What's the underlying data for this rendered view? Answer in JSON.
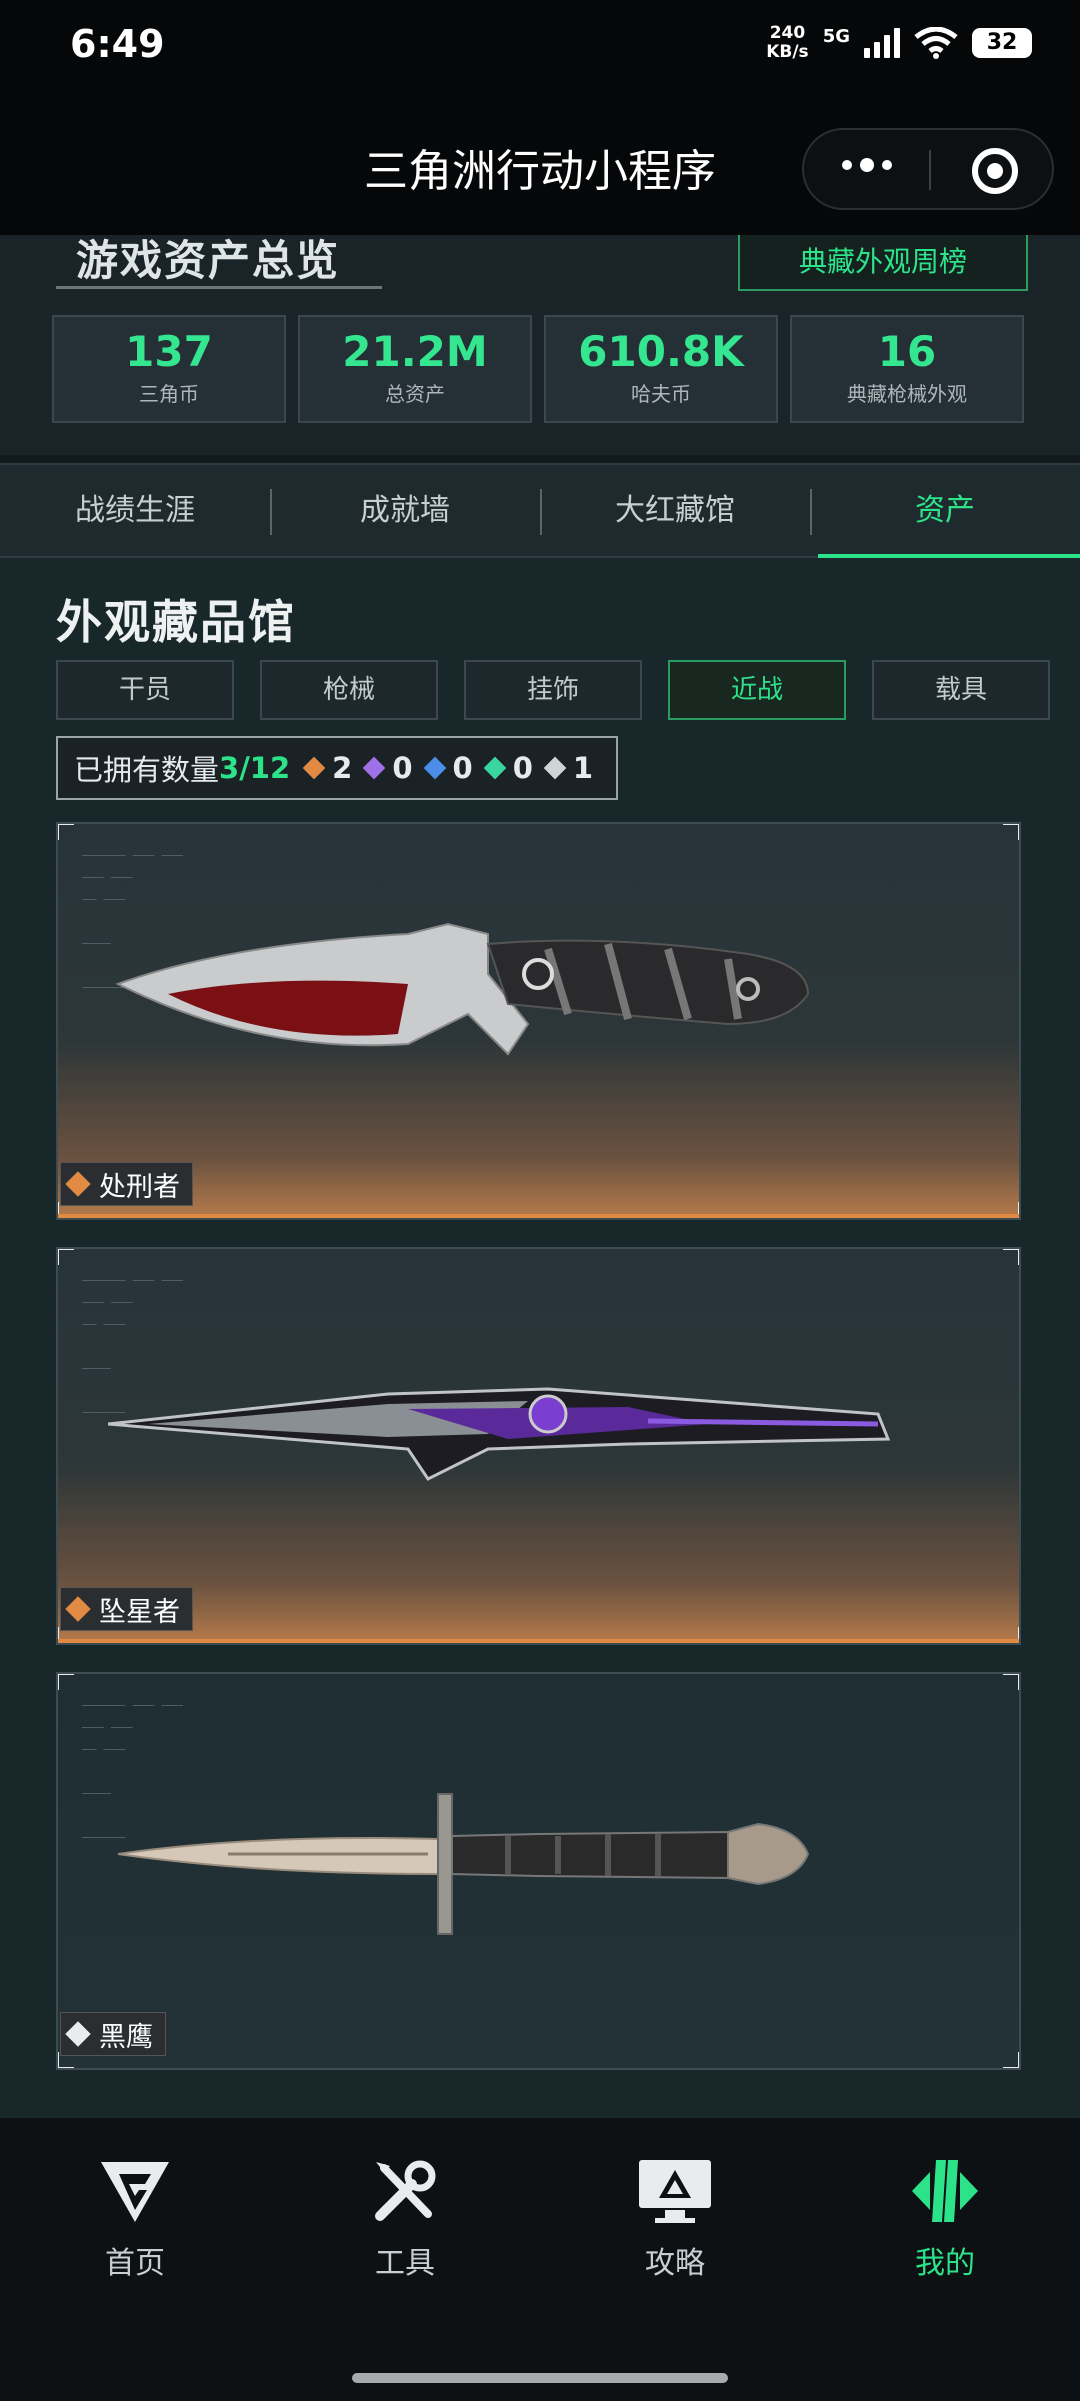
{
  "status_bar": {
    "time": "6:49",
    "net_speed_value": "240",
    "net_speed_unit": "KB/s",
    "net_type": "5G",
    "battery": "32"
  },
  "title_bar": {
    "title": "三角洲行动小程序"
  },
  "overview": {
    "title": "游戏资产总览",
    "weekly_button": "典藏外观周榜",
    "stats": [
      {
        "value": "137",
        "label": "三角币"
      },
      {
        "value": "21.2M",
        "label": "总资产"
      },
      {
        "value": "610.8K",
        "label": "哈夫币"
      },
      {
        "value": "16",
        "label": "典藏枪械外观"
      }
    ]
  },
  "tabs": [
    {
      "label": "战绩生涯"
    },
    {
      "label": "成就墙"
    },
    {
      "label": "大红藏馆"
    },
    {
      "label": "资产"
    }
  ],
  "gallery": {
    "title": "外观藏品馆",
    "filters": [
      {
        "label": "干员"
      },
      {
        "label": "枪械"
      },
      {
        "label": "挂饰"
      },
      {
        "label": "近战"
      },
      {
        "label": "载具"
      }
    ],
    "owned_label": "已拥有数量",
    "owned_count": "3/12",
    "rarity_counts": [
      {
        "value": "2",
        "color": "#e08a44"
      },
      {
        "value": "0",
        "color": "#a070e8"
      },
      {
        "value": "0",
        "color": "#4a8ee8"
      },
      {
        "value": "0",
        "color": "#3ad6a0"
      },
      {
        "value": "1",
        "color": "#d0d4d6"
      }
    ],
    "items": [
      {
        "name": "处刑者",
        "rarity_color": "#e08a44"
      },
      {
        "name": "坠星者",
        "rarity_color": "#e08a44"
      },
      {
        "name": "黑鹰",
        "rarity_color": "#e8ecee"
      }
    ]
  },
  "bottom_nav": [
    {
      "label": "首页",
      "icon": "home-logo-icon"
    },
    {
      "label": "工具",
      "icon": "tools-icon"
    },
    {
      "label": "攻略",
      "icon": "guide-monitor-icon"
    },
    {
      "label": "我的",
      "icon": "profile-logo-icon"
    }
  ],
  "colors": {
    "accent_green": "#2de38a",
    "gold_rarity": "#e08a44"
  }
}
